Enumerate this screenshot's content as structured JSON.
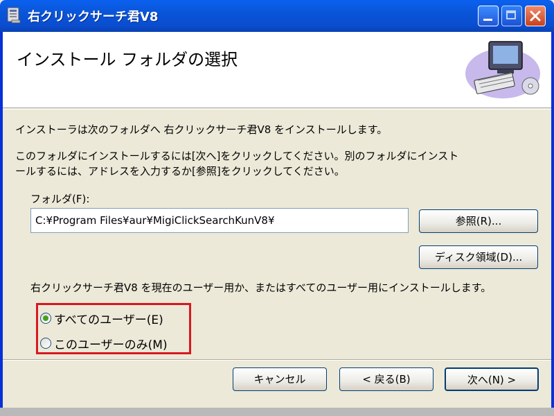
{
  "window": {
    "title": "右クリックサーチ君V8"
  },
  "banner": {
    "title": "インストール フォルダの選択",
    "art_icon": "computer-install-icon"
  },
  "body": {
    "line1": "インストーラは次のフォルダへ 右クリックサーチ君V8 をインストールします。",
    "line2a": "このフォルダにインストールするには[次へ]をクリックしてください。別のフォルダにインスト",
    "line2b": "ールするには、アドレスを入力するか[参照]をクリックしてください。",
    "folder_label": "フォルダ(F):",
    "folder_value": "C:¥Program Files¥aur¥MigiClickSearchKunV8¥",
    "install_for_text": "右クリックサーチ君V8 を現在のユーザー用か、またはすべてのユーザー用にインストールします。"
  },
  "buttons": {
    "browse": "参照(R)...",
    "disk_space": "ディスク領域(D)...",
    "cancel": "キャンセル",
    "back": "< 戻る(B)",
    "next": "次へ(N) >"
  },
  "radios": {
    "all_users": {
      "label": "すべてのユーザー(E)",
      "checked": true
    },
    "this_user": {
      "label": "このユーザーのみ(M)",
      "checked": false
    }
  },
  "colors": {
    "title_bar": "#0a54d6",
    "highlight": "#d81820",
    "radio_dot": "#46a01c"
  }
}
